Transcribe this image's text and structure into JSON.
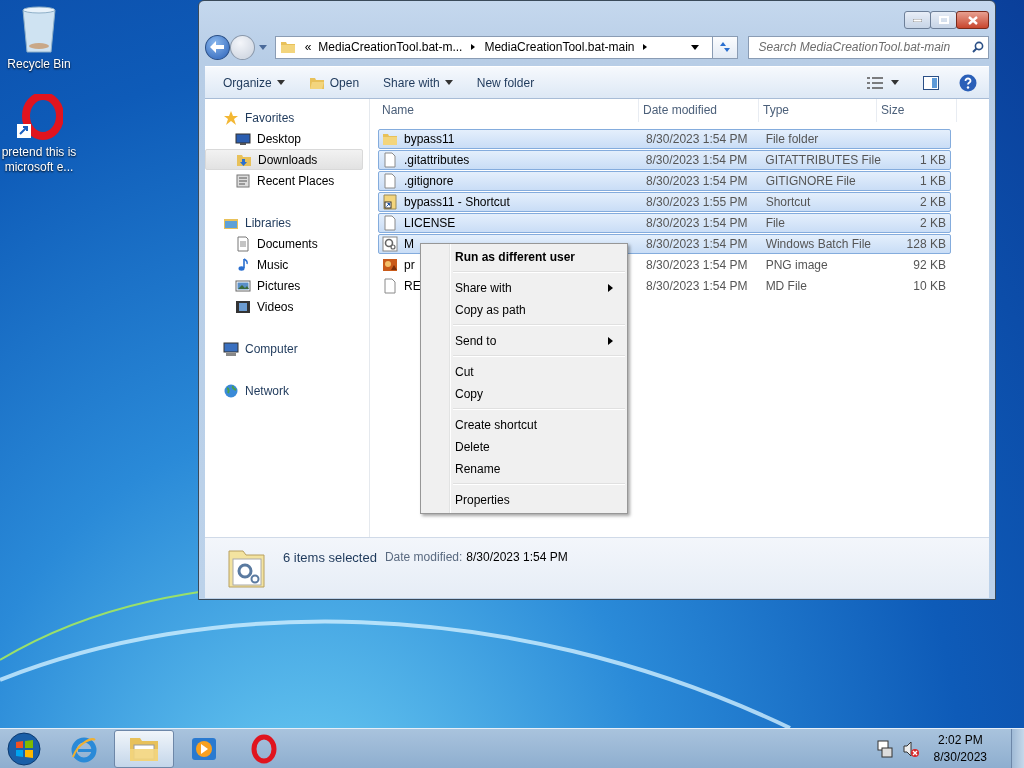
{
  "desktop_icons": [
    {
      "kind": "recycle-bin",
      "label": "Recycle Bin"
    },
    {
      "kind": "opera-shortcut",
      "label": "pretend this is microsoft e..."
    }
  ],
  "window": {
    "address": [
      "«",
      "MediaCreationTool.bat-m...",
      "MediaCreationTool.bat-main"
    ],
    "search": {
      "placeholder": "Search MediaCreationTool.bat-main"
    },
    "toolbar": [
      {
        "label": "Organize",
        "kind": "plain",
        "dropdown": true
      },
      {
        "label": "Open",
        "kind": "open",
        "dropdown": false
      },
      {
        "label": "Share with",
        "kind": "plain",
        "dropdown": true
      },
      {
        "label": "New folder",
        "kind": "plain",
        "dropdown": false
      }
    ],
    "navigation": [
      {
        "label": "Favorites",
        "kind": "star",
        "selected": false,
        "children": [
          {
            "label": "Desktop",
            "kind": "desktop",
            "selected": false
          },
          {
            "label": "Downloads",
            "kind": "downloads",
            "selected": true
          },
          {
            "label": "Recent Places",
            "kind": "recent",
            "selected": false
          }
        ]
      },
      {
        "label": "Libraries",
        "kind": "library",
        "selected": false,
        "children": [
          {
            "label": "Documents",
            "kind": "documents",
            "selected": false
          },
          {
            "label": "Music",
            "kind": "music",
            "selected": false
          },
          {
            "label": "Pictures",
            "kind": "pictures",
            "selected": false
          },
          {
            "label": "Videos",
            "kind": "videos",
            "selected": false
          }
        ]
      },
      {
        "label": "Computer",
        "kind": "computer",
        "selected": false
      },
      {
        "label": "Network",
        "kind": "network",
        "selected": false
      }
    ],
    "columns": [
      "Name",
      "Date modified",
      "Type",
      "Size"
    ],
    "files": [
      {
        "kind": "folder",
        "name": "bypass11",
        "date": "8/30/2023 1:54 PM",
        "type": "File folder",
        "selected": true
      },
      {
        "kind": "file",
        "name": ".gitattributes",
        "date": "8/30/2023 1:54 PM",
        "type": "GITATTRIBUTES File",
        "size": "1 KB",
        "selected": true
      },
      {
        "kind": "file",
        "name": ".gitignore",
        "date": "8/30/2023 1:54 PM",
        "type": "GITIGNORE File",
        "size": "1 KB",
        "selected": true
      },
      {
        "kind": "shortcut",
        "name": "bypass11 - Shortcut",
        "date": "8/30/2023 1:55 PM",
        "type": "Shortcut",
        "size": "2 KB",
        "selected": true
      },
      {
        "kind": "file",
        "name": "LICENSE",
        "date": "8/30/2023 1:54 PM",
        "type": "File",
        "size": "2 KB",
        "selected": true
      },
      {
        "kind": "batch",
        "name": "M",
        "date": "8/30/2023 1:54 PM",
        "type": "Windows Batch File",
        "size": "128 KB",
        "selected": true
      },
      {
        "kind": "image",
        "name": "pr",
        "date": "8/30/2023 1:54 PM",
        "type": "PNG image",
        "size": "92 KB",
        "selected": false
      },
      {
        "kind": "file",
        "name": "RE",
        "date": "8/30/2023 1:54 PM",
        "type": "MD File",
        "size": "10 KB",
        "selected": false
      }
    ],
    "details": {
      "summary": "6 items selected",
      "label": "Date modified:",
      "value": "8/30/2023 1:54 PM"
    }
  },
  "context_menu": {
    "groups": [
      [
        {
          "label": "Run as different user",
          "default": true,
          "submenu": false
        }
      ],
      [
        {
          "label": "Share with",
          "default": false,
          "submenu": true
        },
        {
          "label": "Copy as path",
          "default": false,
          "submenu": false
        }
      ],
      [
        {
          "label": "Send to",
          "default": false,
          "submenu": true
        }
      ],
      [
        {
          "label": "Cut",
          "default": false,
          "submenu": false
        },
        {
          "label": "Copy",
          "default": false,
          "submenu": false
        }
      ],
      [
        {
          "label": "Create shortcut",
          "default": false,
          "submenu": false
        },
        {
          "label": "Delete",
          "default": false,
          "submenu": false
        },
        {
          "label": "Rename",
          "default": false,
          "submenu": false
        }
      ],
      [
        {
          "label": "Properties",
          "default": false,
          "submenu": false
        }
      ]
    ]
  },
  "taskbar": {
    "apps": [
      {
        "kind": "browser",
        "active": false
      },
      {
        "kind": "folder",
        "active": true
      },
      {
        "kind": "media",
        "active": false
      },
      {
        "kind": "opera",
        "active": false
      }
    ],
    "clock": {
      "time": "2:02 PM",
      "date": "8/30/2023"
    }
  }
}
